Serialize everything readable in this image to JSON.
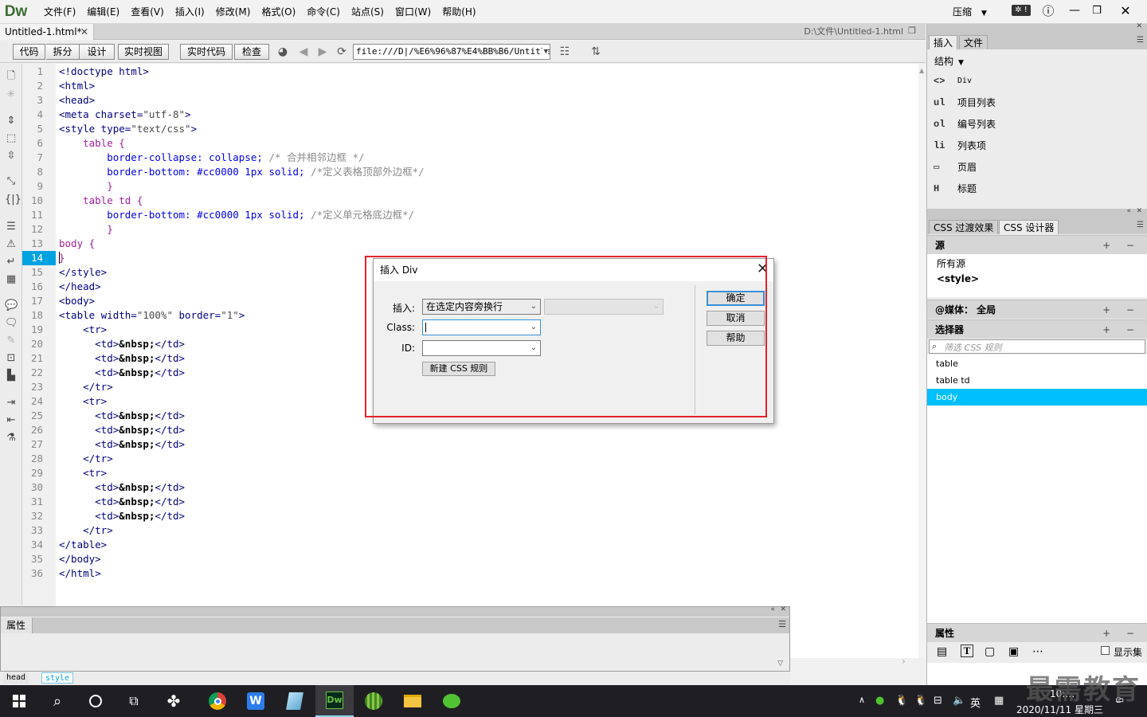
{
  "app": {
    "logo": "Dw",
    "workspace": "压缩"
  },
  "menu": [
    "文件(F)",
    "编辑(E)",
    "查看(V)",
    "插入(I)",
    "修改(M)",
    "格式(O)",
    "命令(C)",
    "站点(S)",
    "窗口(W)",
    "帮助(H)"
  ],
  "doc": {
    "tab": "Untitled-1.html*",
    "path": "D:\\文件\\Untitled-1.html"
  },
  "toolbar": {
    "views": [
      "代码",
      "拆分",
      "设计",
      "实时视图"
    ],
    "live_code": "实时代码",
    "inspect": "检查",
    "address": "file:///D|/%E6%96%87%E4%BB%B6/Untitled"
  },
  "code": {
    "active_line": 14,
    "line_numbers": [
      "1",
      "2",
      "3",
      "4",
      "5",
      "6",
      "7",
      "8",
      "9",
      "10",
      "11",
      "12",
      "13",
      "14",
      "15",
      "16",
      "17",
      "18",
      "19",
      "20",
      "21",
      "22",
      "23",
      "24",
      "25",
      "26",
      "27",
      "28",
      "29",
      "30",
      "31",
      "32",
      "33",
      "34",
      "35",
      "36"
    ],
    "tokens": {
      "l1": "<!doctype html>",
      "l2": "<html>",
      "l3": "<head>",
      "l4a": "<meta charset=",
      "l4b": "\"utf-8\"",
      "l4c": ">",
      "l5a": "<style type=",
      "l5b": "\"text/css\"",
      "l5c": ">",
      "l6": "    table {",
      "l7a": "        border-collapse",
      "l7b": ": collapse;",
      "l7c": " /* 合并相邻边框 */",
      "l8a": "        border-bottom",
      "l8b": ": #cc0000 1px solid;",
      "l8c": " /*定义表格顶部外边框*/",
      "l9": "        }",
      "l10": "    table td {",
      "l11a": "        border-bottom",
      "l11b": ": #cc0000 1px solid;",
      "l11c": " /*定义单元格底边框*/",
      "l12": "        }",
      "l13": "body {",
      "l14": "}",
      "l15": "</style>",
      "l16": "</head>",
      "l17": "<body>",
      "l18a": "<table width=",
      "l18b": "\"100%\"",
      "l18c": " border=",
      "l18d": "\"1\"",
      "l18e": ">",
      "tr_open": "    <tr>",
      "tr_close": "    </tr>",
      "td_open": "      <td>",
      "nbsp": "&nbsp;",
      "td_close": "</td>",
      "l34": "</table>",
      "l35": "</body>",
      "l36": "</html>"
    }
  },
  "properties": {
    "title": "属性"
  },
  "status_tags": [
    "head",
    "style"
  ],
  "right_panel": {
    "tabs": [
      "插入",
      "文件"
    ],
    "category": "结构",
    "insert_items": [
      {
        "icon": "div-icon",
        "glyph": "<>",
        "label": "Div"
      },
      {
        "icon": "ul-icon",
        "glyph": "ul",
        "label": "项目列表"
      },
      {
        "icon": "ol-icon",
        "glyph": "ol",
        "label": "编号列表"
      },
      {
        "icon": "li-icon",
        "glyph": "li",
        "label": "列表项"
      },
      {
        "icon": "header-icon",
        "glyph": "▭",
        "label": "页眉"
      },
      {
        "icon": "heading-icon",
        "glyph": "H",
        "label": "标题"
      }
    ],
    "css_tabs": [
      "CSS 过渡效果",
      "CSS 设计器"
    ],
    "sources_header": "源",
    "sources": [
      "所有源",
      "<style>"
    ],
    "media_header": "@媒体： 全局",
    "selectors_header": "选择器",
    "filter_placeholder": "筛选 CSS 规则",
    "selectors": [
      "table",
      "table td",
      "body"
    ],
    "selected": "body",
    "properties_header": "属性",
    "show_set": "显示集"
  },
  "dialog": {
    "title": "插入 Div",
    "insert_label": "插入:",
    "insert_value": "在选定内容旁换行",
    "class_label": "Class:",
    "class_value": "",
    "id_label": "ID:",
    "id_value": "",
    "new_css": "新建 CSS 规则",
    "ok": "确定",
    "cancel": "取消",
    "help": "帮助"
  },
  "taskbar": {
    "lang": "英",
    "time": "10:…",
    "date": "2020/11/11 星期三",
    "notif": "2"
  },
  "watermark": "最需教育",
  "colors": {
    "accent": "#00a3e0",
    "highlight_box": "#e2232a",
    "selected_row": "#00bfff"
  }
}
